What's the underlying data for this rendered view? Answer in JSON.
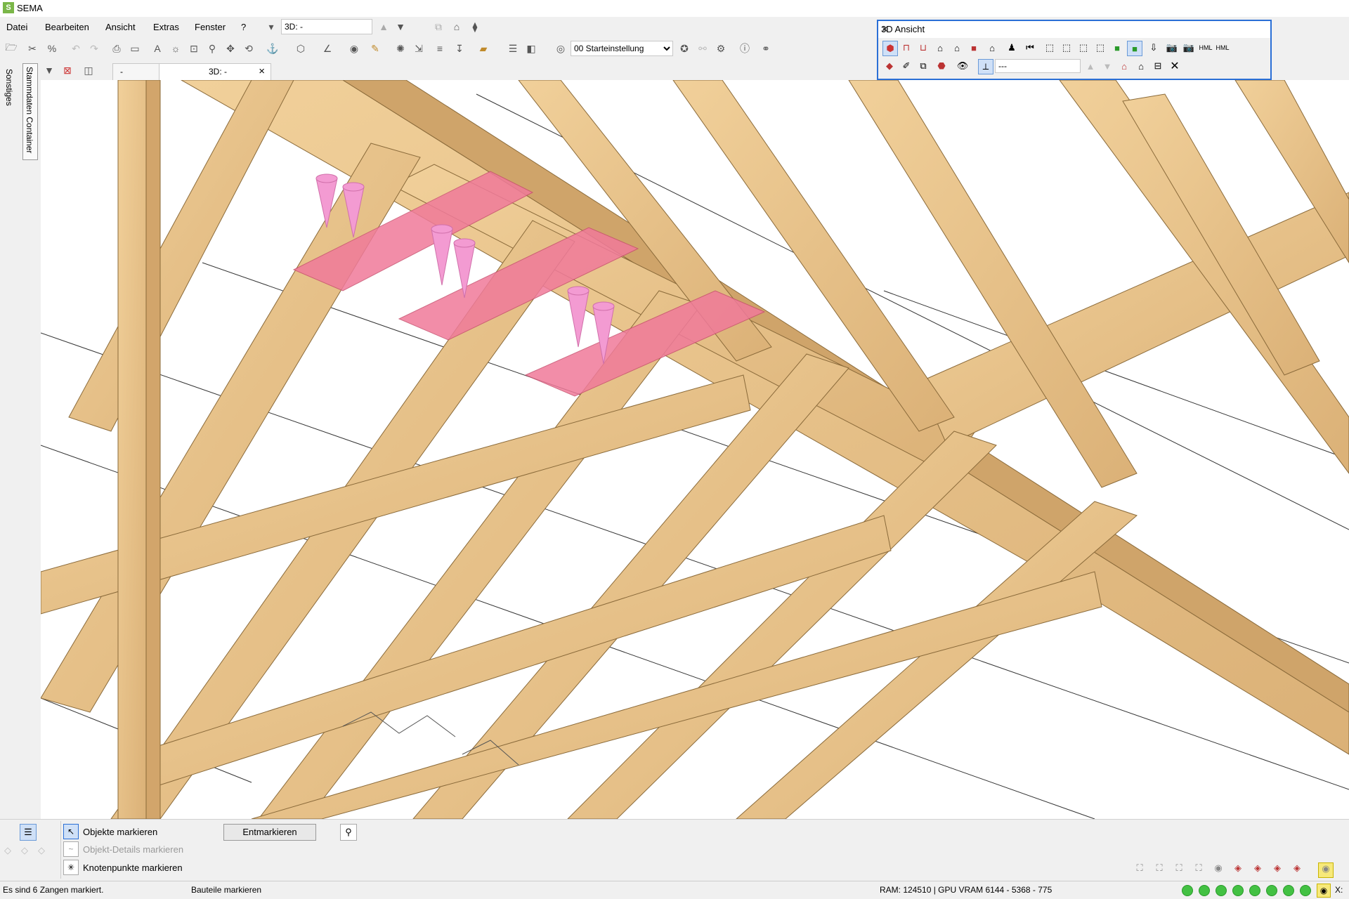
{
  "app": {
    "title": "SEMA",
    "logo": "S"
  },
  "menu": [
    "Datei",
    "Bearbeiten",
    "Ansicht",
    "Extras",
    "Fenster",
    "?"
  ],
  "toolbar": {
    "view_input_value": "3D: -",
    "preset_value": "00 Starteinstellung"
  },
  "left_strip": {
    "vtabs": [
      "Sonstiges",
      "Stammdaten Container"
    ]
  },
  "tabs": [
    {
      "label": "-"
    },
    {
      "label": "3D: -",
      "close": "×"
    }
  ],
  "panel3d": {
    "title": "3D Ansicht",
    "close": "✕",
    "combo_value": "---",
    "hml_labels": [
      "HML",
      "HML"
    ]
  },
  "bottom": {
    "options": [
      "Objekte markieren",
      "Objekt-Details markieren",
      "Knotenpunkte markieren"
    ],
    "unmark_label": "Entmarkieren"
  },
  "status": {
    "message": "Es sind 6 Zangen markiert.",
    "mode": "Bauteile markieren",
    "memory": "RAM: 124510 | GPU VRAM 6144 - 5368 - 775",
    "coord_label": "X:"
  },
  "colors": {
    "selection_blue": "#2a6fd6",
    "wood": "#e9c48a",
    "wood_dark": "#c99a5b",
    "highlight_pink": "#f07a9a",
    "status_green": "#43c143"
  }
}
